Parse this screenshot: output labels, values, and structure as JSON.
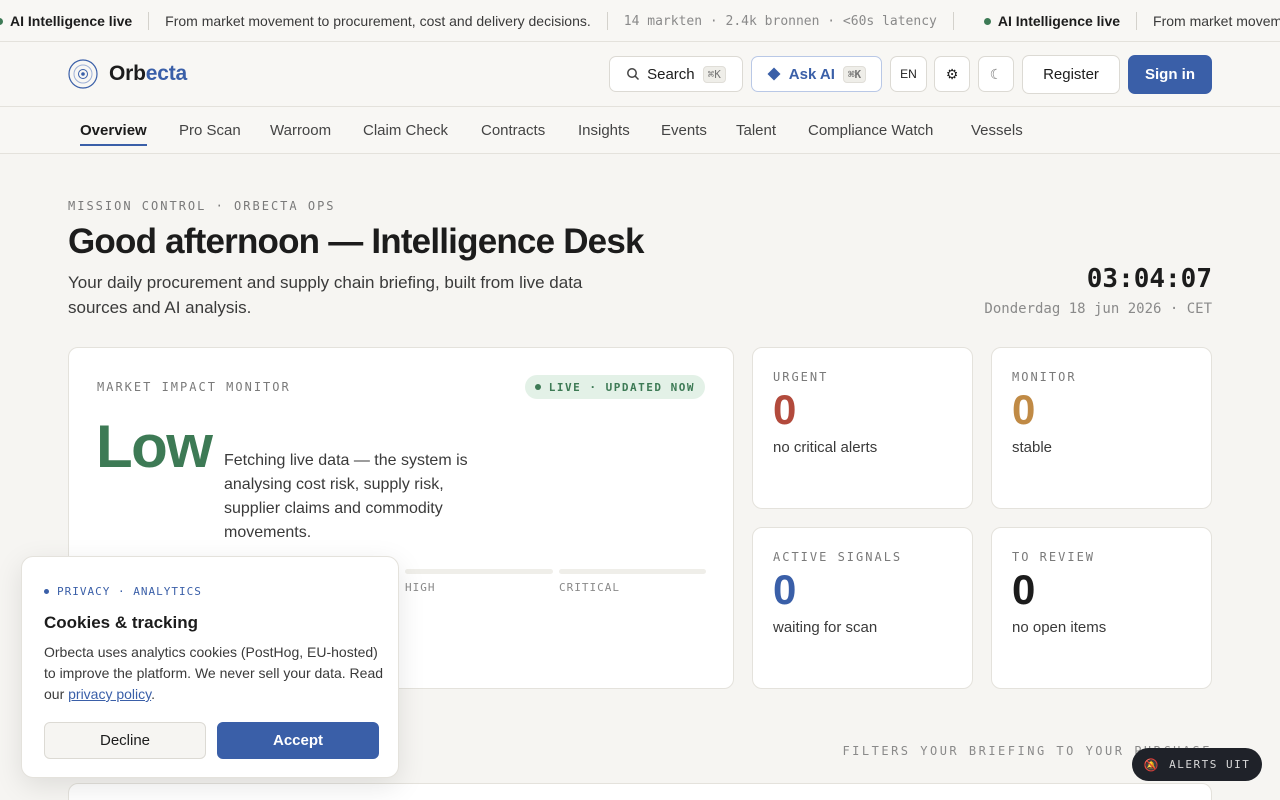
{
  "ticker": {
    "live_label": "AI Intelligence live",
    "message": "From market movement to procurement, cost and delivery decisions.",
    "meta": "14 markten · 2.4k bronnen · <60s latency",
    "repeat_live_label": "AI Intelligence live",
    "repeat_message": "From market movement to procurement, cost and delivery decisions."
  },
  "header": {
    "logo_part1": "Orb",
    "logo_part2": "ecta",
    "search_label": "Search",
    "search_shortcut": "⌘K",
    "ask_label": "Ask AI",
    "ask_shortcut": "⌘K",
    "language": "EN",
    "register_label": "Register",
    "signin_label": "Sign in"
  },
  "nav": {
    "items": [
      "Overview",
      "Pro Scan",
      "Warroom",
      "Claim Check",
      "Contracts",
      "Insights",
      "Events",
      "Talent",
      "Compliance Watch",
      "Vessels"
    ],
    "active_index": 0
  },
  "hero": {
    "eyebrow": "MISSION CONTROL · ORBECTA OPS",
    "title": "Good afternoon — Intelligence Desk",
    "lede": "Your daily procurement and supply chain briefing, built from live data sources and AI analysis.",
    "clock": "03:04:07",
    "date": "Donderdag 18 jun 2026 · CET"
  },
  "impact": {
    "label": "MARKET IMPACT MONITOR",
    "status": "LIVE · UPDATED NOW",
    "level": "Low",
    "description": "Fetching live data — the system is analysing cost risk, supply risk, supplier claims and commodity movements.",
    "scale_labels": [
      "HIGH",
      "CRITICAL"
    ]
  },
  "stats": [
    {
      "label": "URGENT",
      "value": "0",
      "sub": "no critical alerts",
      "color": "#b24a3c"
    },
    {
      "label": "MONITOR",
      "value": "0",
      "sub": "stable",
      "color": "#c08a45"
    },
    {
      "label": "ACTIVE SIGNALS",
      "value": "0",
      "sub": "waiting for scan",
      "color": "#3a5fa8"
    },
    {
      "label": "TO REVIEW",
      "value": "0",
      "sub": "no open items",
      "color": "#1c1c1c"
    }
  ],
  "lower": {
    "filters_note": "FILTERS YOUR BRIEFING TO YOUR PURCHASE"
  },
  "cookie": {
    "tag": "PRIVACY · ANALYTICS",
    "title": "Cookies & tracking",
    "body": "Orbecta uses analytics cookies (PostHog, EU-hosted) to improve the platform. We never sell your data. Read our",
    "link": "privacy policy",
    "body_end": ".",
    "decline_label": "Decline",
    "accept_label": "Accept"
  },
  "alerts": {
    "label": "ALERTS UIT",
    "icon": "bell-off-icon"
  },
  "colors": {
    "accent": "#3a5fa8",
    "live_green": "#3d7a55"
  }
}
